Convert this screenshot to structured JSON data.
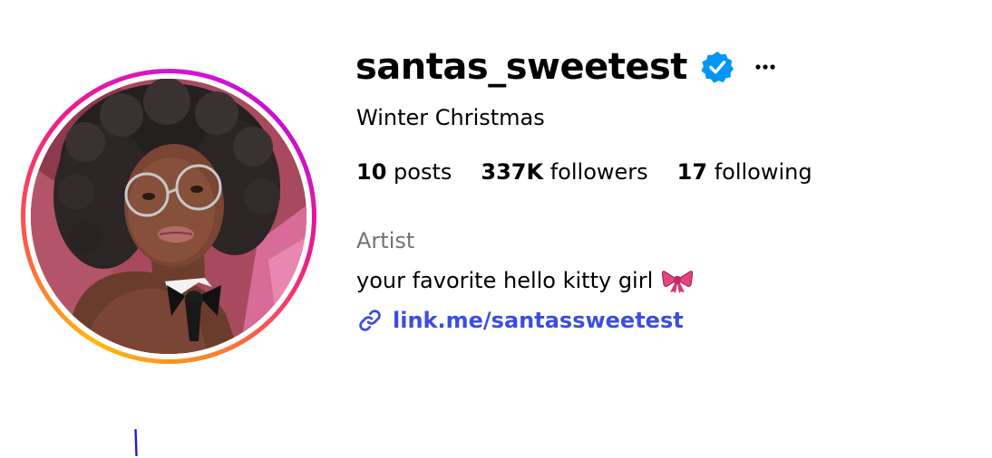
{
  "profile": {
    "username": "santas_sweetest",
    "verified": true,
    "display_name": "Winter Christmas",
    "stats": [
      {
        "count": "10",
        "label": "posts"
      },
      {
        "count": "337K",
        "label": "followers"
      },
      {
        "count": "17",
        "label": "following"
      }
    ],
    "category": "Artist",
    "bio": "your favorite hello kitty girl",
    "link": "link.me/santassweetest"
  },
  "icons": {
    "verified": "verified-badge-icon",
    "more": "more-options-icon",
    "bio_emoji": "ribbon-bow-icon",
    "link": "link-icon"
  },
  "colors": {
    "verified_blue": "#0095f6",
    "link_blue": "#3c4ede",
    "secondary_text": "#737373",
    "story_ring": [
      "#fdb90f",
      "#fd5949",
      "#f01b8a",
      "#c90fd0"
    ]
  }
}
